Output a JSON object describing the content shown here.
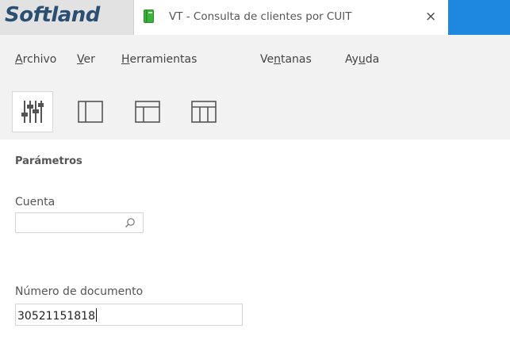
{
  "app": {
    "brand": "Softland"
  },
  "tab": {
    "title": "VT - Consulta de clientes por CUIT",
    "close_glyph": "×",
    "icon": "notebook-icon"
  },
  "colors": {
    "brand": "#2a4f72",
    "accent": "#1e88e0",
    "tab_icon": "#3cb43c"
  },
  "menu": {
    "items": [
      {
        "pre": "",
        "acc": "A",
        "post": "rchivo"
      },
      {
        "pre": "",
        "acc": "V",
        "post": "er"
      },
      {
        "pre": "",
        "acc": "H",
        "post": "erramientas"
      },
      {
        "pre": "Ve",
        "acc": "n",
        "post": "tanas"
      },
      {
        "pre": "Ay",
        "acc": "u",
        "post": "da"
      }
    ]
  },
  "toolbar": {
    "buttons": [
      "parameters-sliders-icon",
      "layout-left-panel-icon",
      "layout-top-panel-icon",
      "layout-columns-icon"
    ]
  },
  "params": {
    "title": "Parámetros",
    "cuenta": {
      "label": "Cuenta",
      "value": "",
      "placeholder": ""
    },
    "documento": {
      "label": "Número de documento",
      "value": "30521151818"
    }
  }
}
